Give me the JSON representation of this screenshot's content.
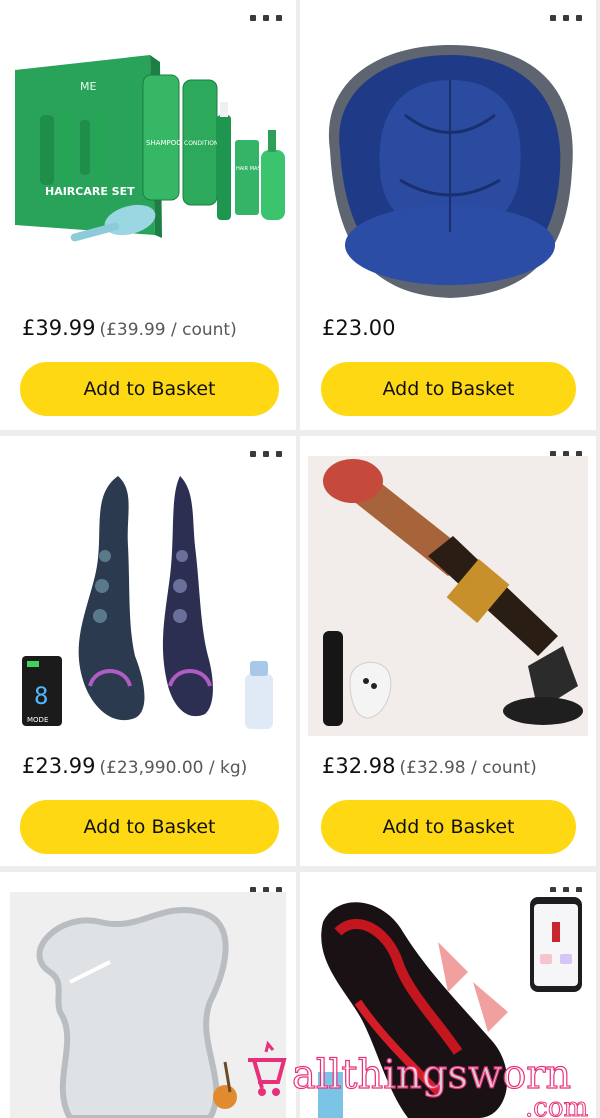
{
  "products": [
    {
      "price": "£39.99",
      "unit_price": "(£39.99 / count)",
      "button_label": "Add to Basket",
      "image": "haircare-set-image",
      "image_text": [
        "ME",
        "HAIRCARE SET",
        "SHAMPOO",
        "CONDITIONER",
        "HAIR MASK"
      ]
    },
    {
      "price": "£23.00",
      "unit_price": "",
      "button_label": "Add to Basket",
      "image": "seat-cushion-image"
    },
    {
      "price": "£23.99",
      "unit_price": "(£23,990.00 / kg)",
      "button_label": "Add to Basket",
      "image": "tentacle-toy-image",
      "image_text": [
        "8",
        "MODE"
      ]
    },
    {
      "price": "£32.98",
      "unit_price": "(£32.98 / count)",
      "button_label": "Add to Basket",
      "image": "thrusting-machine-image"
    },
    {
      "price": "",
      "unit_price": "",
      "button_label": "",
      "image": "wavy-mirror-image"
    },
    {
      "price": "",
      "unit_price": "",
      "button_label": "",
      "image": "red-black-toy-image"
    }
  ],
  "watermark": {
    "text": "allthingsworn",
    "suffix": ".com"
  },
  "colors": {
    "button": "#ffd814",
    "background": "#ededed",
    "card": "#ffffff"
  }
}
